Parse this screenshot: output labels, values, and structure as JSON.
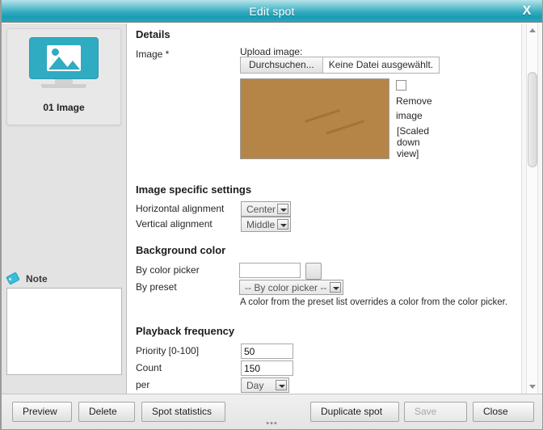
{
  "window": {
    "title": "Edit spot",
    "close_label": "X"
  },
  "sidebar": {
    "spot": {
      "label": "01 Image",
      "icon": "monitor-image-icon"
    },
    "note": {
      "label": "Note",
      "icon": "tag-icon",
      "value": "",
      "placeholder": ""
    }
  },
  "main": {
    "details": {
      "heading": "Details",
      "image_label": "Image *",
      "upload_caption": "Upload image:",
      "browse_button": "Durchsuchen...",
      "file_name": "Keine Datei ausgewählt.",
      "remove_label": "Remove image",
      "scaled_note": "[Scaled down view]",
      "preview_alt": "bread-loaves-photo"
    },
    "image_settings": {
      "heading": "Image specific settings",
      "horizontal_label": "Horizontal alignment",
      "horizontal_value": "Center",
      "vertical_label": "Vertical alignment",
      "vertical_value": "Middle"
    },
    "background_color": {
      "heading": "Background color",
      "picker_label": "By color picker",
      "picker_value": "",
      "preset_label": "By preset",
      "preset_value": "-- By color picker --",
      "hint": "A color from the preset list overrides a color from the color picker."
    },
    "playback": {
      "heading": "Playback frequency",
      "priority_label": "Priority [0-100]",
      "priority_value": "50",
      "count_label": "Count",
      "count_value": "150",
      "per_label": "per",
      "per_value": "Day"
    }
  },
  "footer": {
    "preview": "Preview",
    "delete": "Delete",
    "spot_statistics": "Spot statistics",
    "duplicate_spot": "Duplicate spot",
    "save": "Save",
    "close": "Close",
    "grip": "•••"
  },
  "colors": {
    "titlebar_accent": "#1a9cb4",
    "icon_teal": "#2fabc2",
    "note_icon": "#35c0dd"
  }
}
